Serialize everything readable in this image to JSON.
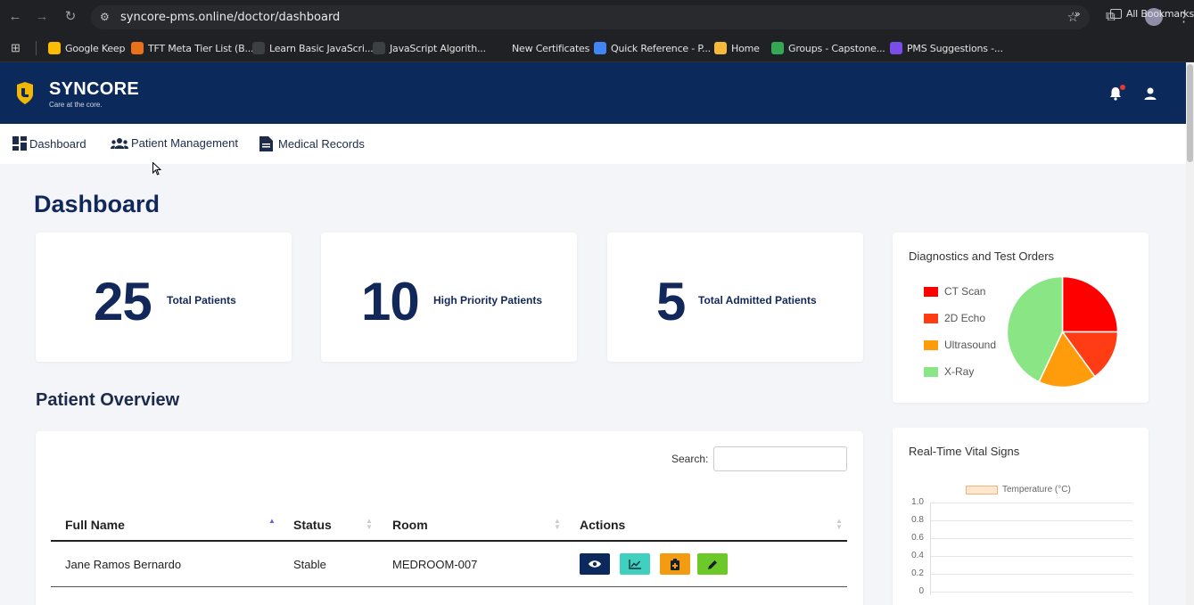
{
  "browser": {
    "url": "syncore-pms.online/doctor/dashboard",
    "bookmarks": [
      {
        "label": "Google Keep",
        "color": "#fbbc04"
      },
      {
        "label": "TFT Meta Tier List (B...",
        "color": "#e8711a"
      },
      {
        "label": "Learn Basic JavaScri...",
        "color": "#3c4043"
      },
      {
        "label": "JavaScript Algorith...",
        "color": "#3c4043"
      },
      {
        "label": "New Certificates",
        "color": "#202124"
      },
      {
        "label": "Quick Reference - P...",
        "color": "#4285f4"
      },
      {
        "label": "Home",
        "color": "#f6b93b"
      },
      {
        "label": "Groups - Capstone...",
        "color": "#34a853"
      },
      {
        "label": "PMS Suggestions -...",
        "color": "#7b4de8"
      }
    ],
    "all_bookmarks": "All Bookmarks",
    "more": "»"
  },
  "header": {
    "brand": "SYNCORE",
    "tagline": "Care at the core.",
    "brand_color": "#0b2a5b",
    "accent": "#f2b705"
  },
  "nav": {
    "items": [
      {
        "label": "Dashboard",
        "icon": "dashboard-icon"
      },
      {
        "label": "Patient Management",
        "icon": "users-icon"
      },
      {
        "label": "Medical Records",
        "icon": "document-icon"
      }
    ]
  },
  "page": {
    "title": "Dashboard"
  },
  "stats": [
    {
      "value": "25",
      "label": "Total Patients"
    },
    {
      "value": "10",
      "label": "High Priority Patients"
    },
    {
      "value": "5",
      "label": "Total Admitted Patients"
    }
  ],
  "diagnostics": {
    "title": "Diagnostics and Test Orders"
  },
  "vitals": {
    "title": "Real-Time Vital Signs"
  },
  "overview": {
    "title": "Patient Overview",
    "search_label": "Search:",
    "search_value": "",
    "columns": [
      "Full Name",
      "Status",
      "Room",
      "Actions"
    ],
    "rows": [
      {
        "name": "Jane Ramos Bernardo",
        "status": "Stable",
        "room": "MEDROOM-007"
      }
    ],
    "actions": [
      {
        "icon": "eye-icon",
        "color": "#0b2a5b"
      },
      {
        "icon": "chart-icon",
        "color": "#3fd0c0"
      },
      {
        "icon": "clipboard-icon",
        "color": "#f39c12"
      },
      {
        "icon": "pencil-icon",
        "color": "#6dc92a"
      }
    ]
  },
  "chart_data": [
    {
      "type": "pie",
      "title": "Diagnostics and Test Orders",
      "categories": [
        "CT Scan",
        "2D Echo",
        "Ultrasound",
        "X-Ray"
      ],
      "values": [
        25,
        15,
        17,
        43
      ],
      "colors": [
        "#ff0000",
        "#ff3c14",
        "#ff9c0c",
        "#8ae584"
      ],
      "legend": "left"
    },
    {
      "type": "line",
      "title": "Real-Time Vital Signs",
      "series": [
        {
          "name": "Temperature (°C)",
          "values": [],
          "color": "#ffd9b3"
        }
      ],
      "ylim": [
        0,
        1.0
      ],
      "yticks": [
        "1.0",
        "0.8",
        "0.6",
        "0.4",
        "0.2",
        "0"
      ],
      "grid": true,
      "legend": "top"
    }
  ]
}
